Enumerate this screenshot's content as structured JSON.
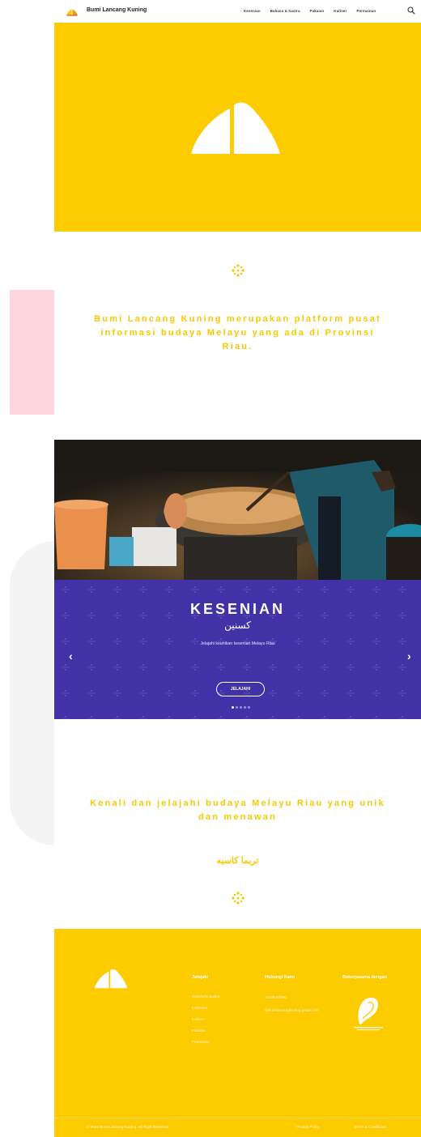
{
  "header": {
    "brand": "Bumi Lancang Kuning",
    "menu": [
      "Kesenian",
      "Bahasa & Sastra",
      "Pakaian",
      "Kuliner",
      "Permainan"
    ]
  },
  "intro": {
    "text": "Bumi Lancang Kuning merupakan platform pusat informasi budaya Melayu yang ada di Provinsi Riau."
  },
  "slider": {
    "title": "KESENIAN",
    "title_arabic": "کسنين",
    "subtitle": "Jelajahi keunikan kesenian Melayu Riau",
    "button": "JELAJAHI",
    "prev": "‹",
    "next": "›",
    "slide_count": 5,
    "active_slide": 1
  },
  "tagline": {
    "text": "Kenali dan jelajahi budaya Melayu Riau yang unik dan menawan",
    "arabic": "تريما كاسيه"
  },
  "footer": {
    "explore": {
      "heading": "Jelajahi",
      "links": [
        "Bahasa & Sastra",
        "Kesenian",
        "Kuliner",
        "Pakaian",
        "Permainan"
      ]
    },
    "contact": {
      "heading": "Hubungi Kami",
      "phone": "12345 67890",
      "email": "@bumilancangkuning.gmail.com"
    },
    "partner": {
      "heading": "Bekerjasama dengan"
    },
    "copyright": "© 2022 Bumi Lancang Kuning. All Right Reserved",
    "privacy": "Privacy Policy",
    "terms": "Terms & Conditions"
  },
  "colors": {
    "yellow": "#fccb00",
    "text_yellow": "#f8c800",
    "purple": "#4331a7"
  }
}
